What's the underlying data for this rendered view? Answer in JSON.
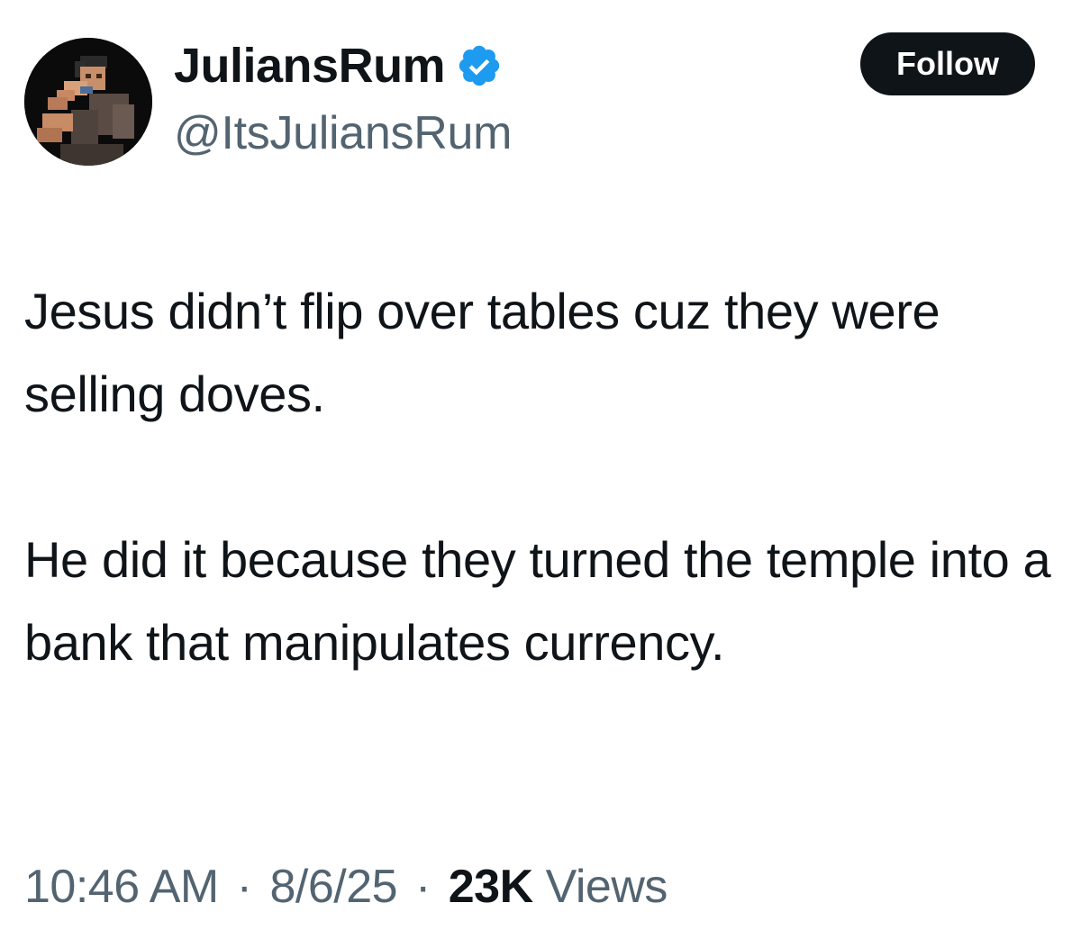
{
  "author": {
    "display_name": "JuliansRum",
    "handle": "@ItsJuliansRum",
    "verified": true,
    "avatar_icon": "pixel-art-avatar-icon"
  },
  "follow_label": "Follow",
  "tweet": {
    "paragraphs": [
      "Jesus didn’t flip over tables cuz they were selling doves.",
      "He did it because they turned the temple into a bank that manipulates currency."
    ]
  },
  "meta": {
    "time": "10:46 AM",
    "date": "8/6/25",
    "separator": "·",
    "views_count": "23K",
    "views_label": "Views"
  },
  "colors": {
    "text_primary": "#0f1419",
    "text_secondary": "#536471",
    "verified_badge": "#1d9bf0",
    "follow_button_bg": "#0f1419"
  }
}
